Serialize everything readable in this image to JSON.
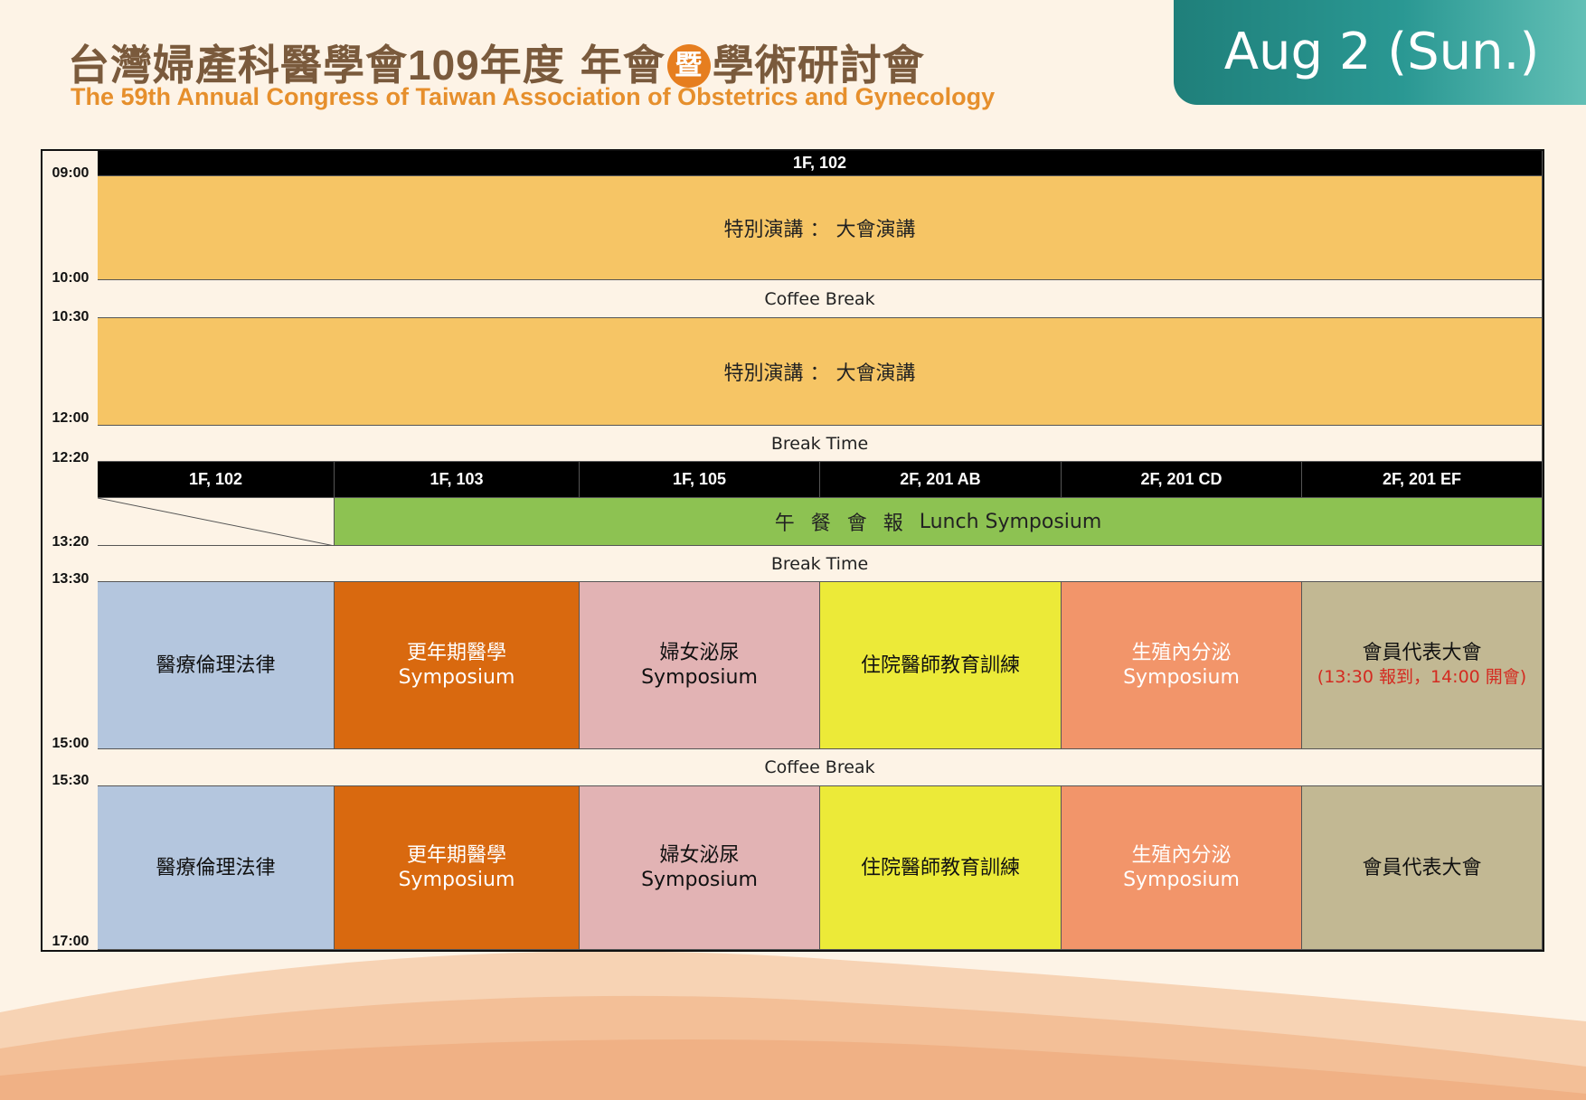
{
  "header": {
    "title_zh_part1": "台灣婦產科醫學會",
    "title_zh_year": "109",
    "title_zh_part2": "年度 年會",
    "title_zh_badge": "暨",
    "title_zh_part3": "學術研討會",
    "title_en": "The 59th Annual Congress of Taiwan Association of Obstetrics and Gynecology",
    "date": "Aug 2 (Sun.)"
  },
  "times": [
    "09:00",
    "10:00",
    "10:30",
    "12:00",
    "12:20",
    "13:20",
    "13:30",
    "15:00",
    "15:30",
    "17:00"
  ],
  "rooms_top": "1F, 102",
  "rooms": [
    "1F, 102",
    "1F, 103",
    "1F, 105",
    "2F, 201 AB",
    "2F, 201 CD",
    "2F, 201 EF"
  ],
  "plenary_1": "特別演講 ： 大會演講",
  "coffee_break_1": "Coffee Break",
  "plenary_2": "特別演講 ： 大會演講",
  "break_time_1": "Break Time",
  "lunch": {
    "zh": "午餐會報",
    "en": "Lunch Symposium"
  },
  "break_time_2": "Break Time",
  "coffee_break_2": "Coffee Break",
  "sessions_afternoon_1": [
    {
      "line1": "醫療倫理法律",
      "line2": ""
    },
    {
      "line1": "更年期醫學",
      "line2": "Symposium"
    },
    {
      "line1": "婦女泌尿",
      "line2": "Symposium"
    },
    {
      "line1": "住院醫師教育訓練",
      "line2": ""
    },
    {
      "line1": "生殖內分泌",
      "line2": "Symposium"
    },
    {
      "line1": "會員代表大會",
      "line2": "(13:30 報到，14:00 開會)"
    }
  ],
  "sessions_afternoon_2": [
    {
      "line1": "醫療倫理法律",
      "line2": ""
    },
    {
      "line1": "更年期醫學",
      "line2": "Symposium"
    },
    {
      "line1": "婦女泌尿",
      "line2": "Symposium"
    },
    {
      "line1": "住院醫師教育訓練",
      "line2": ""
    },
    {
      "line1": "生殖內分泌",
      "line2": "Symposium"
    },
    {
      "line1": "會員代表大會",
      "line2": ""
    }
  ],
  "colors": {
    "plenary": "#f6c565",
    "lunch": "#8dc252",
    "sessions": [
      "#b4c6de",
      "#d9690f",
      "#e2b3b4",
      "#ecea38",
      "#f2956a",
      "#c2b893"
    ],
    "session_text": [
      "#111111",
      "#ffffff",
      "#111111",
      "#111111",
      "#ffffff",
      "#111111"
    ],
    "note": "#d42a20",
    "date_tab": "#1f7f7a"
  }
}
